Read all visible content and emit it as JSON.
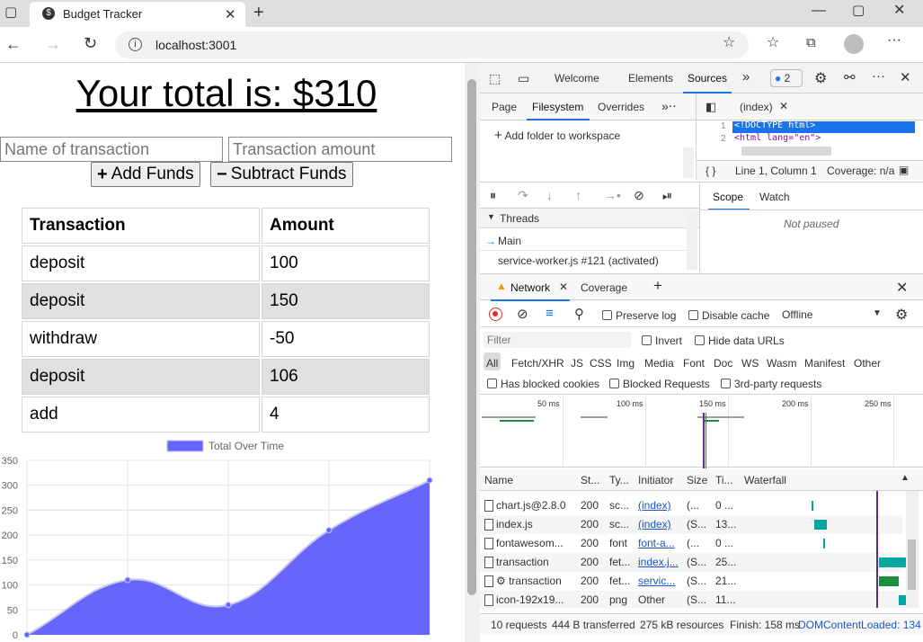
{
  "browser": {
    "tab_title": "Budget Tracker",
    "url": "localhost:3001"
  },
  "budget": {
    "total_text": "Your total is: $310",
    "name_placeholder": "Name of transaction",
    "amount_placeholder": "Transaction amount",
    "add_label": "Add Funds",
    "subtract_label": "Subtract Funds",
    "table_headers": [
      "Transaction",
      "Amount"
    ],
    "rows": [
      {
        "name": "deposit",
        "amount": "100"
      },
      {
        "name": "deposit",
        "amount": "150"
      },
      {
        "name": "withdraw",
        "amount": "-50"
      },
      {
        "name": "deposit",
        "amount": "106"
      },
      {
        "name": "add",
        "amount": "4"
      }
    ]
  },
  "chart_data": {
    "type": "area",
    "title": "",
    "legend": [
      "Total Over Time"
    ],
    "legend_position": "top",
    "series": [
      {
        "name": "Total Over Time",
        "values": [
          0,
          110,
          60,
          210,
          310
        ]
      }
    ],
    "ylim": [
      0,
      350
    ],
    "y_ticks": [
      0,
      50,
      100,
      150,
      200,
      250,
      300,
      350
    ],
    "grid": true,
    "fill_color": "#6666ff"
  },
  "devtools": {
    "main_tabs": [
      "Welcome",
      "Elements",
      "Sources"
    ],
    "issues_count": "2",
    "sources_tabs": [
      "Page",
      "Filesystem",
      "Overrides"
    ],
    "add_folder": "Add folder to workspace",
    "file_tab": "(index)",
    "code_line1": "<!DOCTYPE html>",
    "code_line2": "<html lang=\"en\">",
    "line_num1": "1",
    "line_num2": "2",
    "status_braces": "{ }",
    "status_pos": "Line 1, Column 1",
    "status_coverage": "Coverage: n/a",
    "threads_label": "Threads",
    "thread_main": "Main",
    "thread_worker": "service-worker.js #121 (activated)",
    "scope_tab": "Scope",
    "watch_tab": "Watch",
    "not_paused": "Not paused",
    "drawer_tabs": [
      "Network",
      "Coverage"
    ],
    "preserve_log": "Preserve log",
    "disable_cache": "Disable cache",
    "throttle": "Offline",
    "filter_placeholder": "Filter",
    "invert": "Invert",
    "hide_data_urls": "Hide data URLs",
    "type_filters": [
      "All",
      "Fetch/XHR",
      "JS",
      "CSS",
      "Img",
      "Media",
      "Font",
      "Doc",
      "WS",
      "Wasm",
      "Manifest",
      "Other"
    ],
    "has_blocked_cookies": "Has blocked cookies",
    "blocked_requests": "Blocked Requests",
    "third_party": "3rd-party requests",
    "timeline_ticks": [
      "50 ms",
      "100 ms",
      "150 ms",
      "200 ms",
      "250 ms"
    ],
    "columns": [
      "Name",
      "St...",
      "Ty...",
      "Initiator",
      "Size",
      "Ti...",
      "Waterfall"
    ],
    "requests": [
      {
        "name": "chart.js@2.8.0",
        "status": "200",
        "type": "sc...",
        "initiator": "(index)",
        "size": "(...",
        "time": "0 ..."
      },
      {
        "name": "index.js",
        "status": "200",
        "type": "sc...",
        "initiator": "(index)",
        "size": "(S...",
        "time": "13..."
      },
      {
        "name": "fontawesom...",
        "status": "200",
        "type": "font",
        "initiator": "font-a...",
        "size": "(...",
        "time": "0 ..."
      },
      {
        "name": "transaction",
        "status": "200",
        "type": "fet...",
        "initiator": "index.j...",
        "size": "(S...",
        "time": "25..."
      },
      {
        "name": "⚙ transaction",
        "status": "200",
        "type": "fet...",
        "initiator": "servic...",
        "size": "(S...",
        "time": "21..."
      },
      {
        "name": "icon-192x19...",
        "status": "200",
        "type": "png",
        "initiator": "Other",
        "size": "(S...",
        "time": "11..."
      }
    ],
    "summary_requests": "10 requests",
    "summary_transferred": "444 B transferred",
    "summary_resources": "275 kB resources",
    "summary_finish": "Finish: 158 ms",
    "summary_dcl": "DOMContentLoaded: 134"
  }
}
